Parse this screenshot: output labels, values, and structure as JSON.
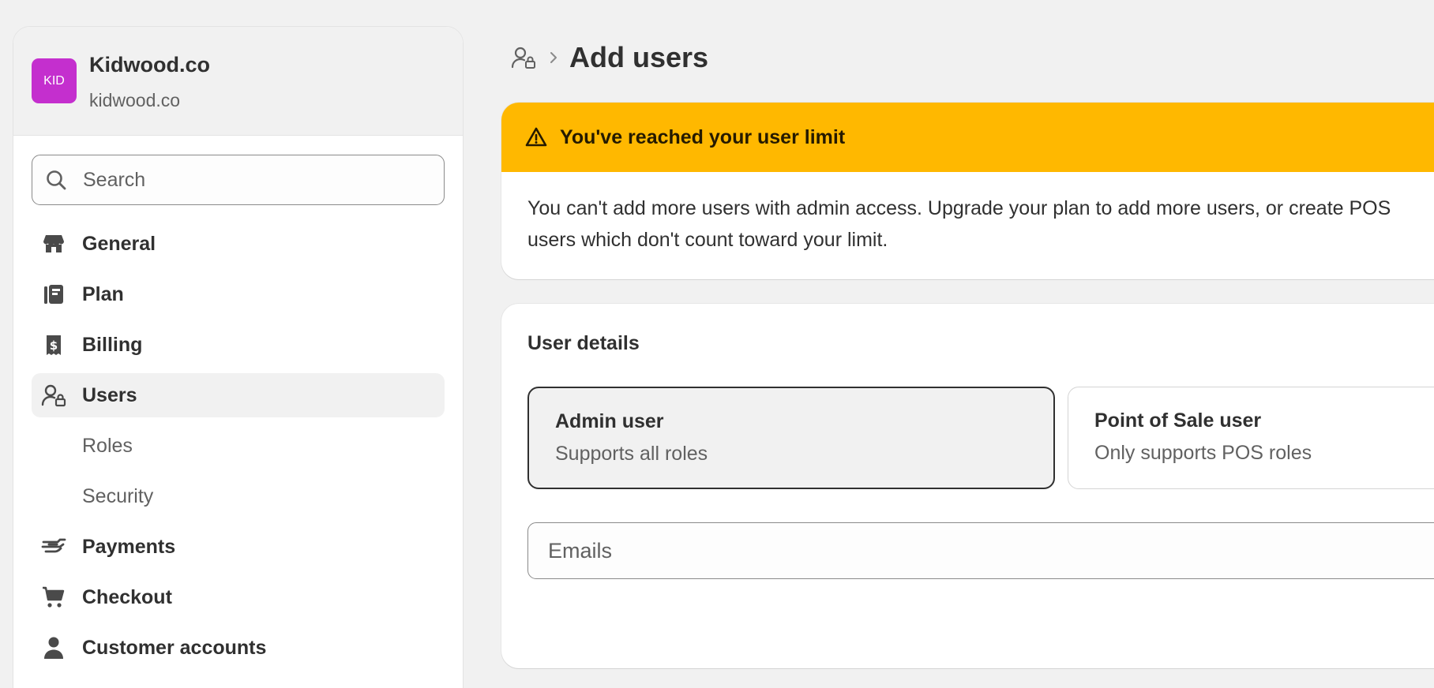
{
  "store": {
    "avatar_text": "KID",
    "name": "Kidwood.co",
    "domain": "kidwood.co",
    "avatar_color": "#c42fce"
  },
  "search": {
    "placeholder": "Search"
  },
  "sidebar": {
    "items": [
      {
        "label": "General",
        "icon": "store-icon"
      },
      {
        "label": "Plan",
        "icon": "plan-icon"
      },
      {
        "label": "Billing",
        "icon": "billing-receipt-icon"
      },
      {
        "label": "Users",
        "icon": "users-icon",
        "active": true
      },
      {
        "label": "Roles",
        "sub": true
      },
      {
        "label": "Security",
        "sub": true
      },
      {
        "label": "Payments",
        "icon": "payments-icon"
      },
      {
        "label": "Checkout",
        "icon": "cart-icon"
      },
      {
        "label": "Customer accounts",
        "icon": "person-icon"
      }
    ]
  },
  "header": {
    "title": "Add users"
  },
  "banner": {
    "title": "You've reached your user limit",
    "body": "You can't add more users with admin access. Upgrade your plan to add more users, or create POS users which don't count toward your limit.",
    "color": "#ffb800"
  },
  "details": {
    "title": "User details",
    "options": [
      {
        "title": "Admin user",
        "desc": "Supports all roles",
        "selected": true
      },
      {
        "title": "Point of Sale user",
        "desc": "Only supports POS roles",
        "selected": false
      }
    ],
    "emails_placeholder": "Emails"
  }
}
